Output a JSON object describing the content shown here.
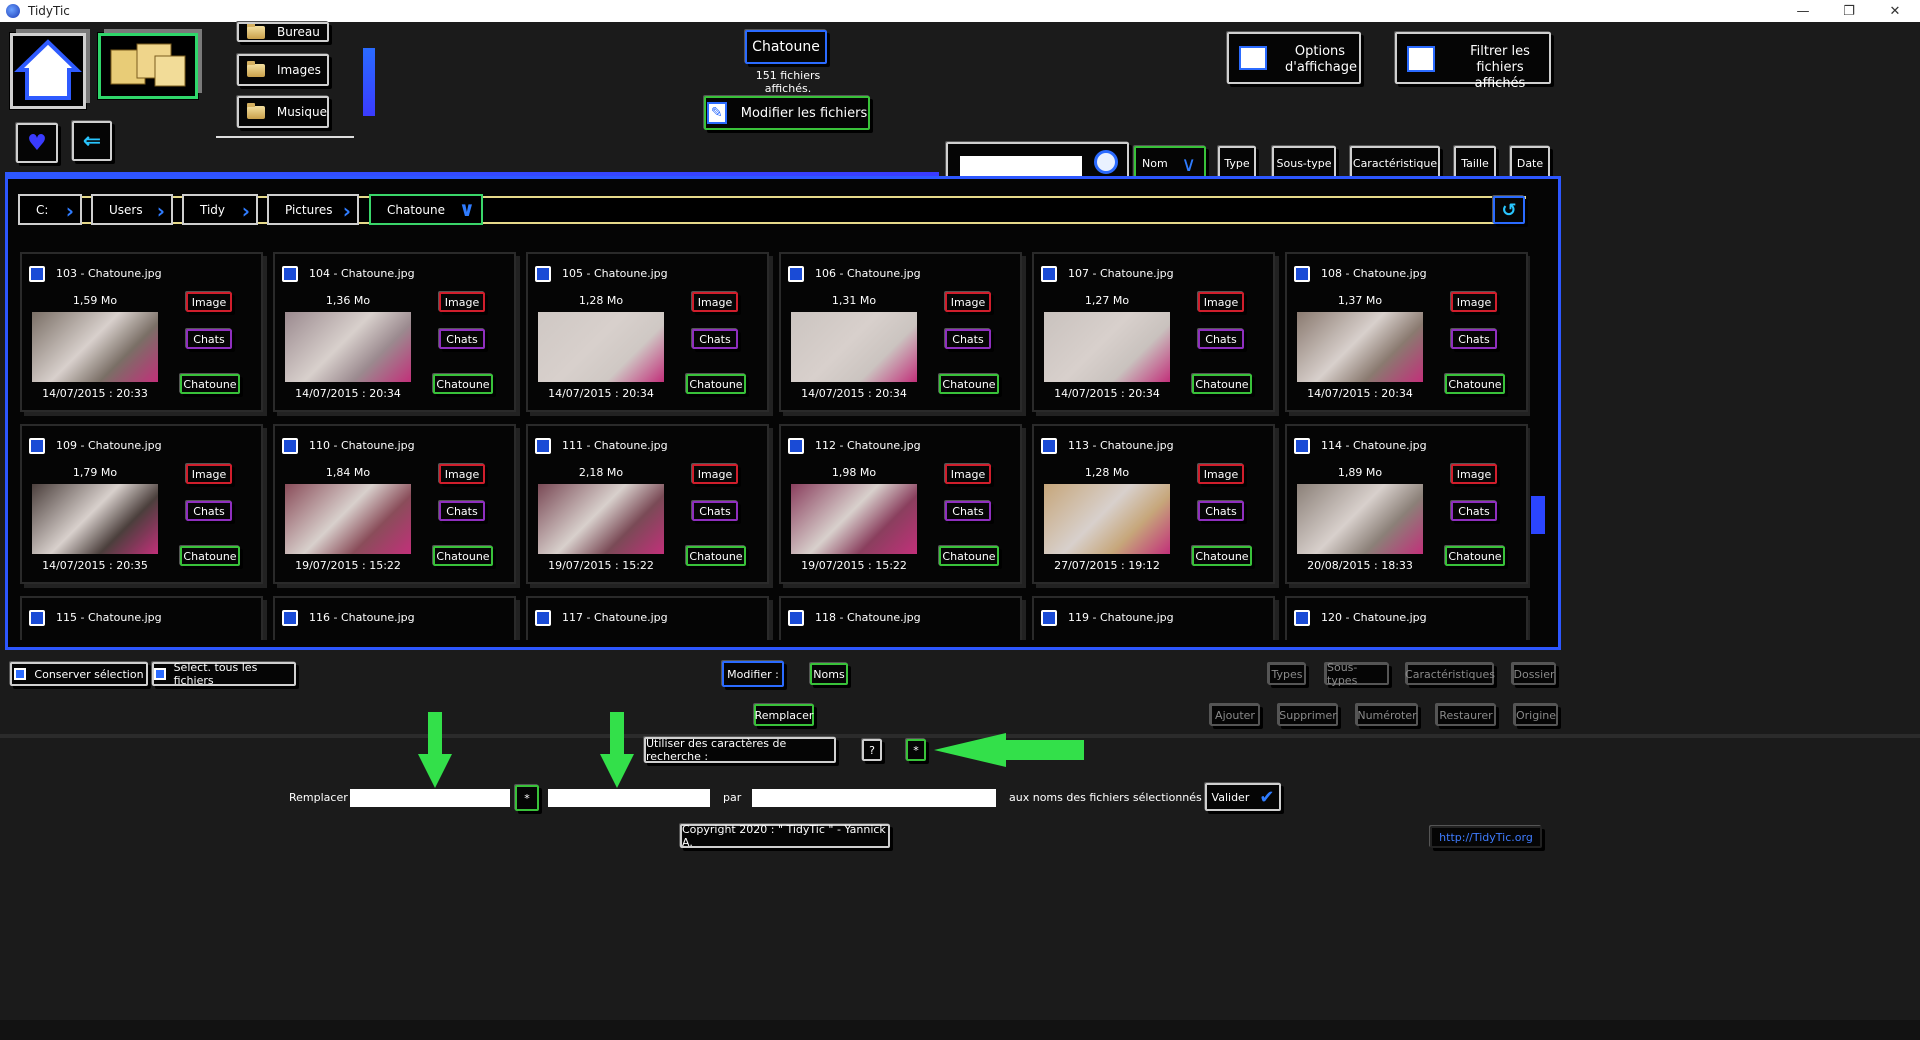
{
  "window": {
    "title": "TidyTic",
    "controls": [
      "—",
      "❐",
      "✕"
    ]
  },
  "nav": {
    "folders": [
      {
        "label": "Bureau"
      },
      {
        "label": "Images"
      },
      {
        "label": "Musique"
      }
    ]
  },
  "header": {
    "folder_name": "Chatoune",
    "file_count": "151 fichiers affichés.",
    "modify_files": "Modifier les fichiers",
    "display_options": "Options d'affichage",
    "filter_files": "Filtrer les fichiers affichés"
  },
  "search": {
    "value": ""
  },
  "sort": {
    "name": "Nom",
    "type": "Type",
    "subtype": "Sous-type",
    "feature": "Caractéristique",
    "size": "Taille",
    "date": "Date"
  },
  "breadcrumb": [
    "C:",
    "Users",
    "Tidy",
    "Pictures",
    "Chatoune"
  ],
  "files": [
    {
      "name": "103 - Chatoune.jpg",
      "size": "1,59 Mo",
      "date": "14/07/2015 : 20:33",
      "tag1": "Image",
      "tag2": "Chats",
      "tag3": "Chatoune",
      "thumb": "#7a6f66"
    },
    {
      "name": "104 - Chatoune.jpg",
      "size": "1,36 Mo",
      "date": "14/07/2015 : 20:34",
      "tag1": "Image",
      "tag2": "Chats",
      "tag3": "Chatoune",
      "thumb": "#9b8a8f"
    },
    {
      "name": "105 - Chatoune.jpg",
      "size": "1,28 Mo",
      "date": "14/07/2015 : 20:34",
      "tag1": "Image",
      "tag2": "Chats",
      "tag3": "Chatoune",
      "thumb": "#cfc8c4"
    },
    {
      "name": "106 - Chatoune.jpg",
      "size": "1,31 Mo",
      "date": "14/07/2015 : 20:34",
      "tag1": "Image",
      "tag2": "Chats",
      "tag3": "Chatoune",
      "thumb": "#cbc4c0"
    },
    {
      "name": "107 - Chatoune.jpg",
      "size": "1,27 Mo",
      "date": "14/07/2015 : 20:34",
      "tag1": "Image",
      "tag2": "Chats",
      "tag3": "Chatoune",
      "thumb": "#c9c2be"
    },
    {
      "name": "108 - Chatoune.jpg",
      "size": "1,37 Mo",
      "date": "14/07/2015 : 20:34",
      "tag1": "Image",
      "tag2": "Chats",
      "tag3": "Chatoune",
      "thumb": "#8a7a70"
    },
    {
      "name": "109 - Chatoune.jpg",
      "size": "1,79 Mo",
      "date": "14/07/2015 : 20:35",
      "tag1": "Image",
      "tag2": "Chats",
      "tag3": "Chatoune",
      "thumb": "#4b3f3c"
    },
    {
      "name": "110 - Chatoune.jpg",
      "size": "1,84 Mo",
      "date": "19/07/2015 : 15:22",
      "tag1": "Image",
      "tag2": "Chats",
      "tag3": "Chatoune",
      "thumb": "#8a4d5a"
    },
    {
      "name": "111 - Chatoune.jpg",
      "size": "2,18 Mo",
      "date": "19/07/2015 : 15:22",
      "tag1": "Image",
      "tag2": "Chats",
      "tag3": "Chatoune",
      "thumb": "#7a4a56"
    },
    {
      "name": "112 - Chatoune.jpg",
      "size": "1,98 Mo",
      "date": "19/07/2015 : 15:22",
      "tag1": "Image",
      "tag2": "Chats",
      "tag3": "Chatoune",
      "thumb": "#8a3f5e"
    },
    {
      "name": "113 - Chatoune.jpg",
      "size": "1,28 Mo",
      "date": "27/07/2015 : 19:12",
      "tag1": "Image",
      "tag2": "Chats",
      "tag3": "Chatoune",
      "thumb": "#c6a67a"
    },
    {
      "name": "114 - Chatoune.jpg",
      "size": "1,89 Mo",
      "date": "20/08/2015 : 18:33",
      "tag1": "Image",
      "tag2": "Chats",
      "tag3": "Chatoune",
      "thumb": "#8b8078"
    },
    {
      "name": "115 - Chatoune.jpg",
      "size": "",
      "date": "",
      "tag1": "",
      "tag2": "",
      "tag3": "",
      "thumb": ""
    },
    {
      "name": "116 - Chatoune.jpg",
      "size": "",
      "date": "",
      "tag1": "",
      "tag2": "",
      "tag3": "",
      "thumb": ""
    },
    {
      "name": "117 - Chatoune.jpg",
      "size": "",
      "date": "",
      "tag1": "",
      "tag2": "",
      "tag3": "",
      "thumb": ""
    },
    {
      "name": "118 - Chatoune.jpg",
      "size": "",
      "date": "",
      "tag1": "",
      "tag2": "",
      "tag3": "",
      "thumb": ""
    },
    {
      "name": "119 - Chatoune.jpg",
      "size": "",
      "date": "",
      "tag1": "",
      "tag2": "",
      "tag3": "",
      "thumb": ""
    },
    {
      "name": "120 - Chatoune.jpg",
      "size": "",
      "date": "",
      "tag1": "",
      "tag2": "",
      "tag3": "",
      "thumb": ""
    }
  ],
  "bottom": {
    "keep_selection": "Conserver sélection",
    "select_all": "Select. tous les fichiers",
    "modify": "Modifier :",
    "names": "Noms",
    "types": "Types",
    "subtypes": "Sous-types",
    "features": "Caractéristiques",
    "folder": "Dossier",
    "replace_btn": "Remplacer",
    "add": "Ajouter",
    "delete": "Supprimer",
    "number": "Numéroter",
    "restore": "Restaurer",
    "origin": "Origine",
    "use_wildcards": "Utiliser des caractères de recherche :",
    "wildcard_q": "?",
    "wildcard_star": "*",
    "replace_label": "Remplacer",
    "star_btn": "*",
    "by_label": "par",
    "target_label": "aux noms des fichiers sélectionnés",
    "validate": "Valider",
    "replace_value": "",
    "replace_value2": "",
    "by_value": ""
  },
  "footer": {
    "copyright": "Copyright 2020 : \" TidyTic \" - Yannick A.",
    "url": "http://TidyTic.org"
  },
  "colors": {
    "accent_blue": "#2d57ff",
    "green": "#39c23a",
    "red": "#d01e2c",
    "purple": "#8f2fbf",
    "arrow_green": "#33e04a"
  }
}
